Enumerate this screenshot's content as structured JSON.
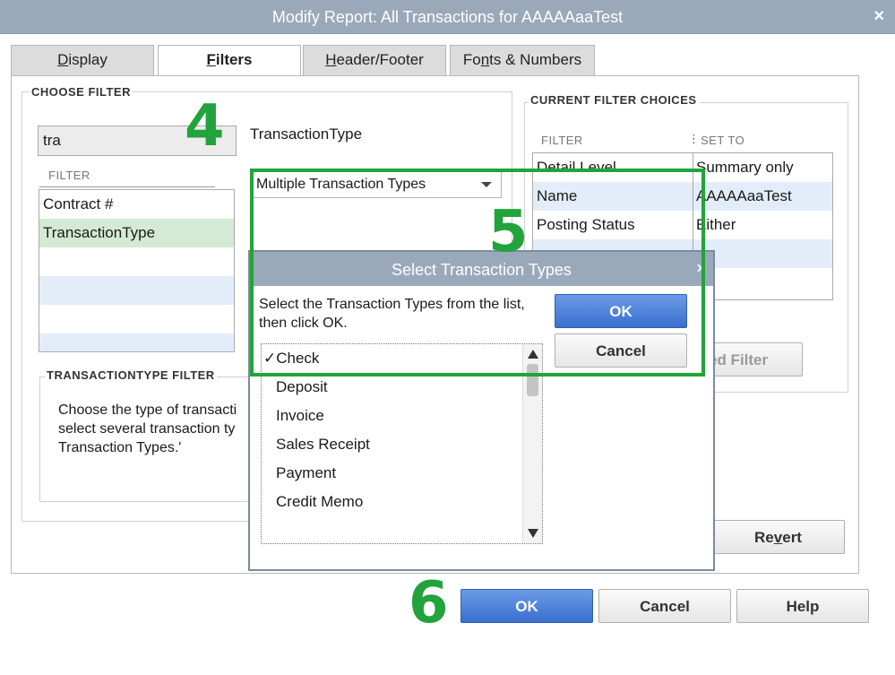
{
  "window": {
    "title": "Modify Report: All Transactions for AAAAAaaTest",
    "close_glyph": "×"
  },
  "tabs": [
    {
      "label_u": "D",
      "label_rest": "isplay"
    },
    {
      "label_u": "F",
      "label_rest": "ilters"
    },
    {
      "label_u": "H",
      "label_rest": "eader/Footer"
    },
    {
      "label_pre": "Fo",
      "label_u": "n",
      "label_rest": "ts & Numbers"
    }
  ],
  "choose_filter": {
    "group_label": "CHOOSE FILTER",
    "search_value": "tra",
    "list_header": "FILTER",
    "items": [
      "Contract #",
      "TransactionType",
      "",
      "",
      "",
      ""
    ]
  },
  "selected_filter": {
    "name": "TransactionType",
    "dropdown_value": "Multiple Transaction Types"
  },
  "description": {
    "group_label": "TRANSACTIONTYPE FILTER",
    "line1": "Choose the type of transacti",
    "line2": "select several transaction ty",
    "line3": "Transaction Types.'"
  },
  "current_choices": {
    "group_label": "CURRENT FILTER CHOICES",
    "col_filter": "FILTER",
    "col_set_to": "SET TO",
    "rows": [
      {
        "filter": "Detail Level",
        "set_to": "Summary only"
      },
      {
        "filter": "Name",
        "set_to": "AAAAAaaTest"
      },
      {
        "filter": "Posting Status",
        "set_to": "Either"
      }
    ],
    "remove_button": "ed Filter"
  },
  "revert_button": {
    "label_pre": "Re",
    "label_u": "v",
    "label_rest": "ert"
  },
  "bottom_buttons": {
    "ok": "OK",
    "cancel": "Cancel",
    "help": "Help"
  },
  "annotations": {
    "step4": "4",
    "step5": "5",
    "step6": "6"
  },
  "dialog": {
    "title": "Select Transaction Types",
    "close_glyph": "×",
    "instructions": "Select the Transaction Types from the list, then click OK.",
    "ok": "OK",
    "cancel": "Cancel",
    "check_mark": "✓",
    "items": [
      "Check",
      "Deposit",
      "Invoice",
      "Sales Receipt",
      "Payment",
      "Credit Memo"
    ]
  },
  "colors": {
    "accent_green": "#22a33b",
    "titlebar": "#9aa9ba",
    "primary_button": "#3a6fcf"
  }
}
